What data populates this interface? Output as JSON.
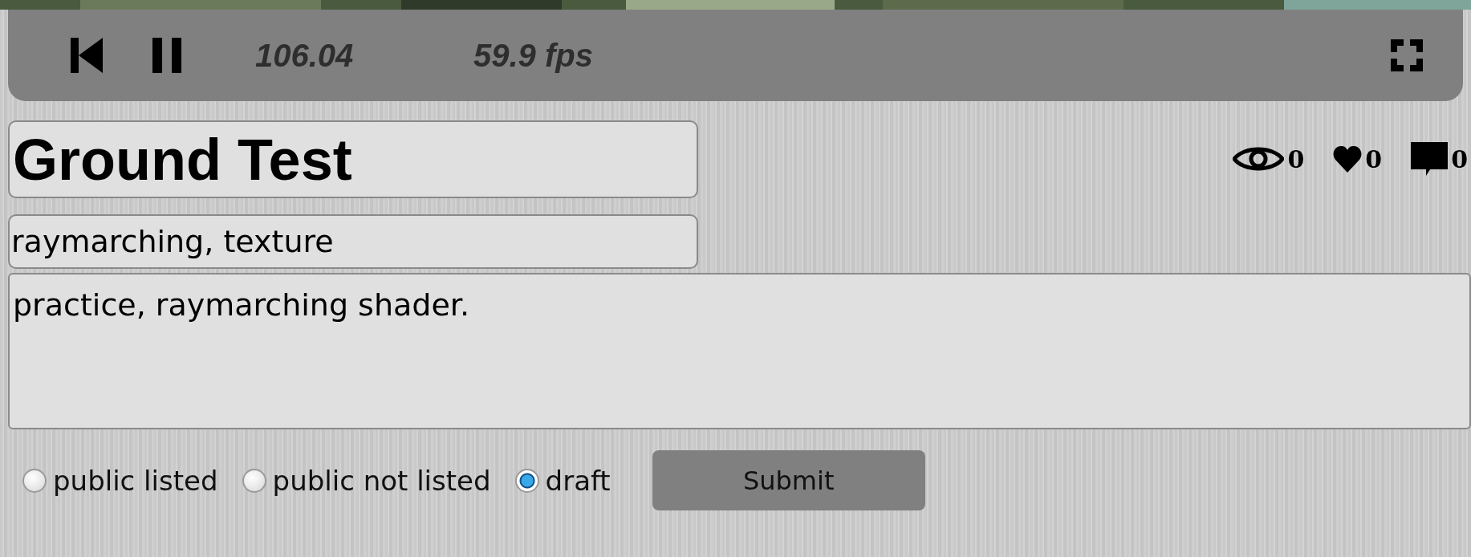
{
  "player": {
    "time": "106.04",
    "fps": "59.9 fps"
  },
  "stats": [
    {
      "kind": "views",
      "count": "0"
    },
    {
      "kind": "likes",
      "count": "0"
    },
    {
      "kind": "comments",
      "count": "0"
    }
  ],
  "title_field": {
    "value": "Ground Test"
  },
  "tags_field": {
    "value": "raymarching, texture"
  },
  "description_field": {
    "value": "practice, raymarching shader."
  },
  "visibility": [
    {
      "label": "public listed",
      "selected": false
    },
    {
      "label": "public not listed",
      "selected": false
    },
    {
      "label": "draft",
      "selected": true
    }
  ],
  "submit_button": {
    "label": "Submit"
  }
}
